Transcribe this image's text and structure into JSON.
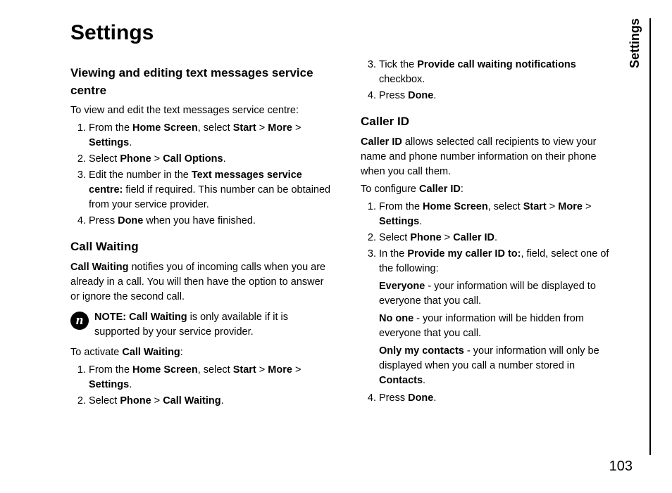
{
  "title": "Settings",
  "side_label": "Settings",
  "page_number": "103",
  "note_icon_glyph": "n",
  "left": {
    "sec1": {
      "heading": "Viewing and editing text messages service centre",
      "intro": "To view and edit the text messages service centre:",
      "li1_a": "From the ",
      "li1_b": "Home Screen",
      "li1_c": ", select ",
      "li1_d": "Start",
      "li1_e": " > ",
      "li1_f": "More",
      "li1_g": " > ",
      "li1_h": "Settings",
      "li1_i": ".",
      "li2_a": "Select ",
      "li2_b": "Phone",
      "li2_c": " > ",
      "li2_d": "Call Options",
      "li2_e": ".",
      "li3_a": "Edit the number in the ",
      "li3_b": "Text messages service centre:",
      "li3_c": " field if required. This number can be obtained from your service provider.",
      "li4_a": "Press ",
      "li4_b": "Done",
      "li4_c": " when you have finished."
    },
    "sec2": {
      "heading": "Call Waiting",
      "p1_a": "Call Waiting",
      "p1_b": " notifies you of incoming calls when you are already in a call. You will then have the option to answer or ignore the second call.",
      "note_a": "NOTE: Call Waiting",
      "note_b": " is only available if it is supported by your service provider.",
      "p2_a": "To activate ",
      "p2_b": "Call Waiting",
      "p2_c": ":",
      "li1_a": "From the ",
      "li1_b": "Home Screen",
      "li1_c": ", select ",
      "li1_d": "Start",
      "li1_e": " > ",
      "li1_f": "More",
      "li1_g": " > ",
      "li1_h": "Settings",
      "li1_i": ".",
      "li2_a": "Select ",
      "li2_b": "Phone",
      "li2_c": " > ",
      "li2_d": "Call Waiting",
      "li2_e": "."
    }
  },
  "right": {
    "cw": {
      "li3_a": "Tick the ",
      "li3_b": "Provide call waiting notifications",
      "li3_c": " checkbox.",
      "li4_a": "Press ",
      "li4_b": "Done",
      "li4_c": "."
    },
    "cid": {
      "heading": "Caller ID",
      "p1_a": "Caller ID",
      "p1_b": " allows selected call recipients to view your name and phone number information on their phone when you call them.",
      "p2_a": "To configure ",
      "p2_b": "Caller ID",
      "p2_c": ":",
      "li1_a": "From the ",
      "li1_b": "Home Screen",
      "li1_c": ", select ",
      "li1_d": "Start",
      "li1_e": " > ",
      "li1_f": "More",
      "li1_g": " > ",
      "li1_h": "Settings",
      "li1_i": ".",
      "li2_a": "Select ",
      "li2_b": "Phone",
      "li2_c": " > ",
      "li2_d": "Caller ID",
      "li2_e": ".",
      "li3_a": "In the ",
      "li3_b": "Provide my caller ID to:",
      "li3_c": ", field, select one of the following:",
      "opt1_a": "Everyone",
      "opt1_b": " - your information will be displayed to everyone that you call.",
      "opt2_a": "No one",
      "opt2_b": " - your information will be hidden from everyone that you call.",
      "opt3_a": "Only my contacts",
      "opt3_b": " - your information will only be displayed when you call a number stored in ",
      "opt3_c": "Contacts",
      "opt3_d": ".",
      "li4_a": "Press ",
      "li4_b": "Done",
      "li4_c": "."
    }
  }
}
